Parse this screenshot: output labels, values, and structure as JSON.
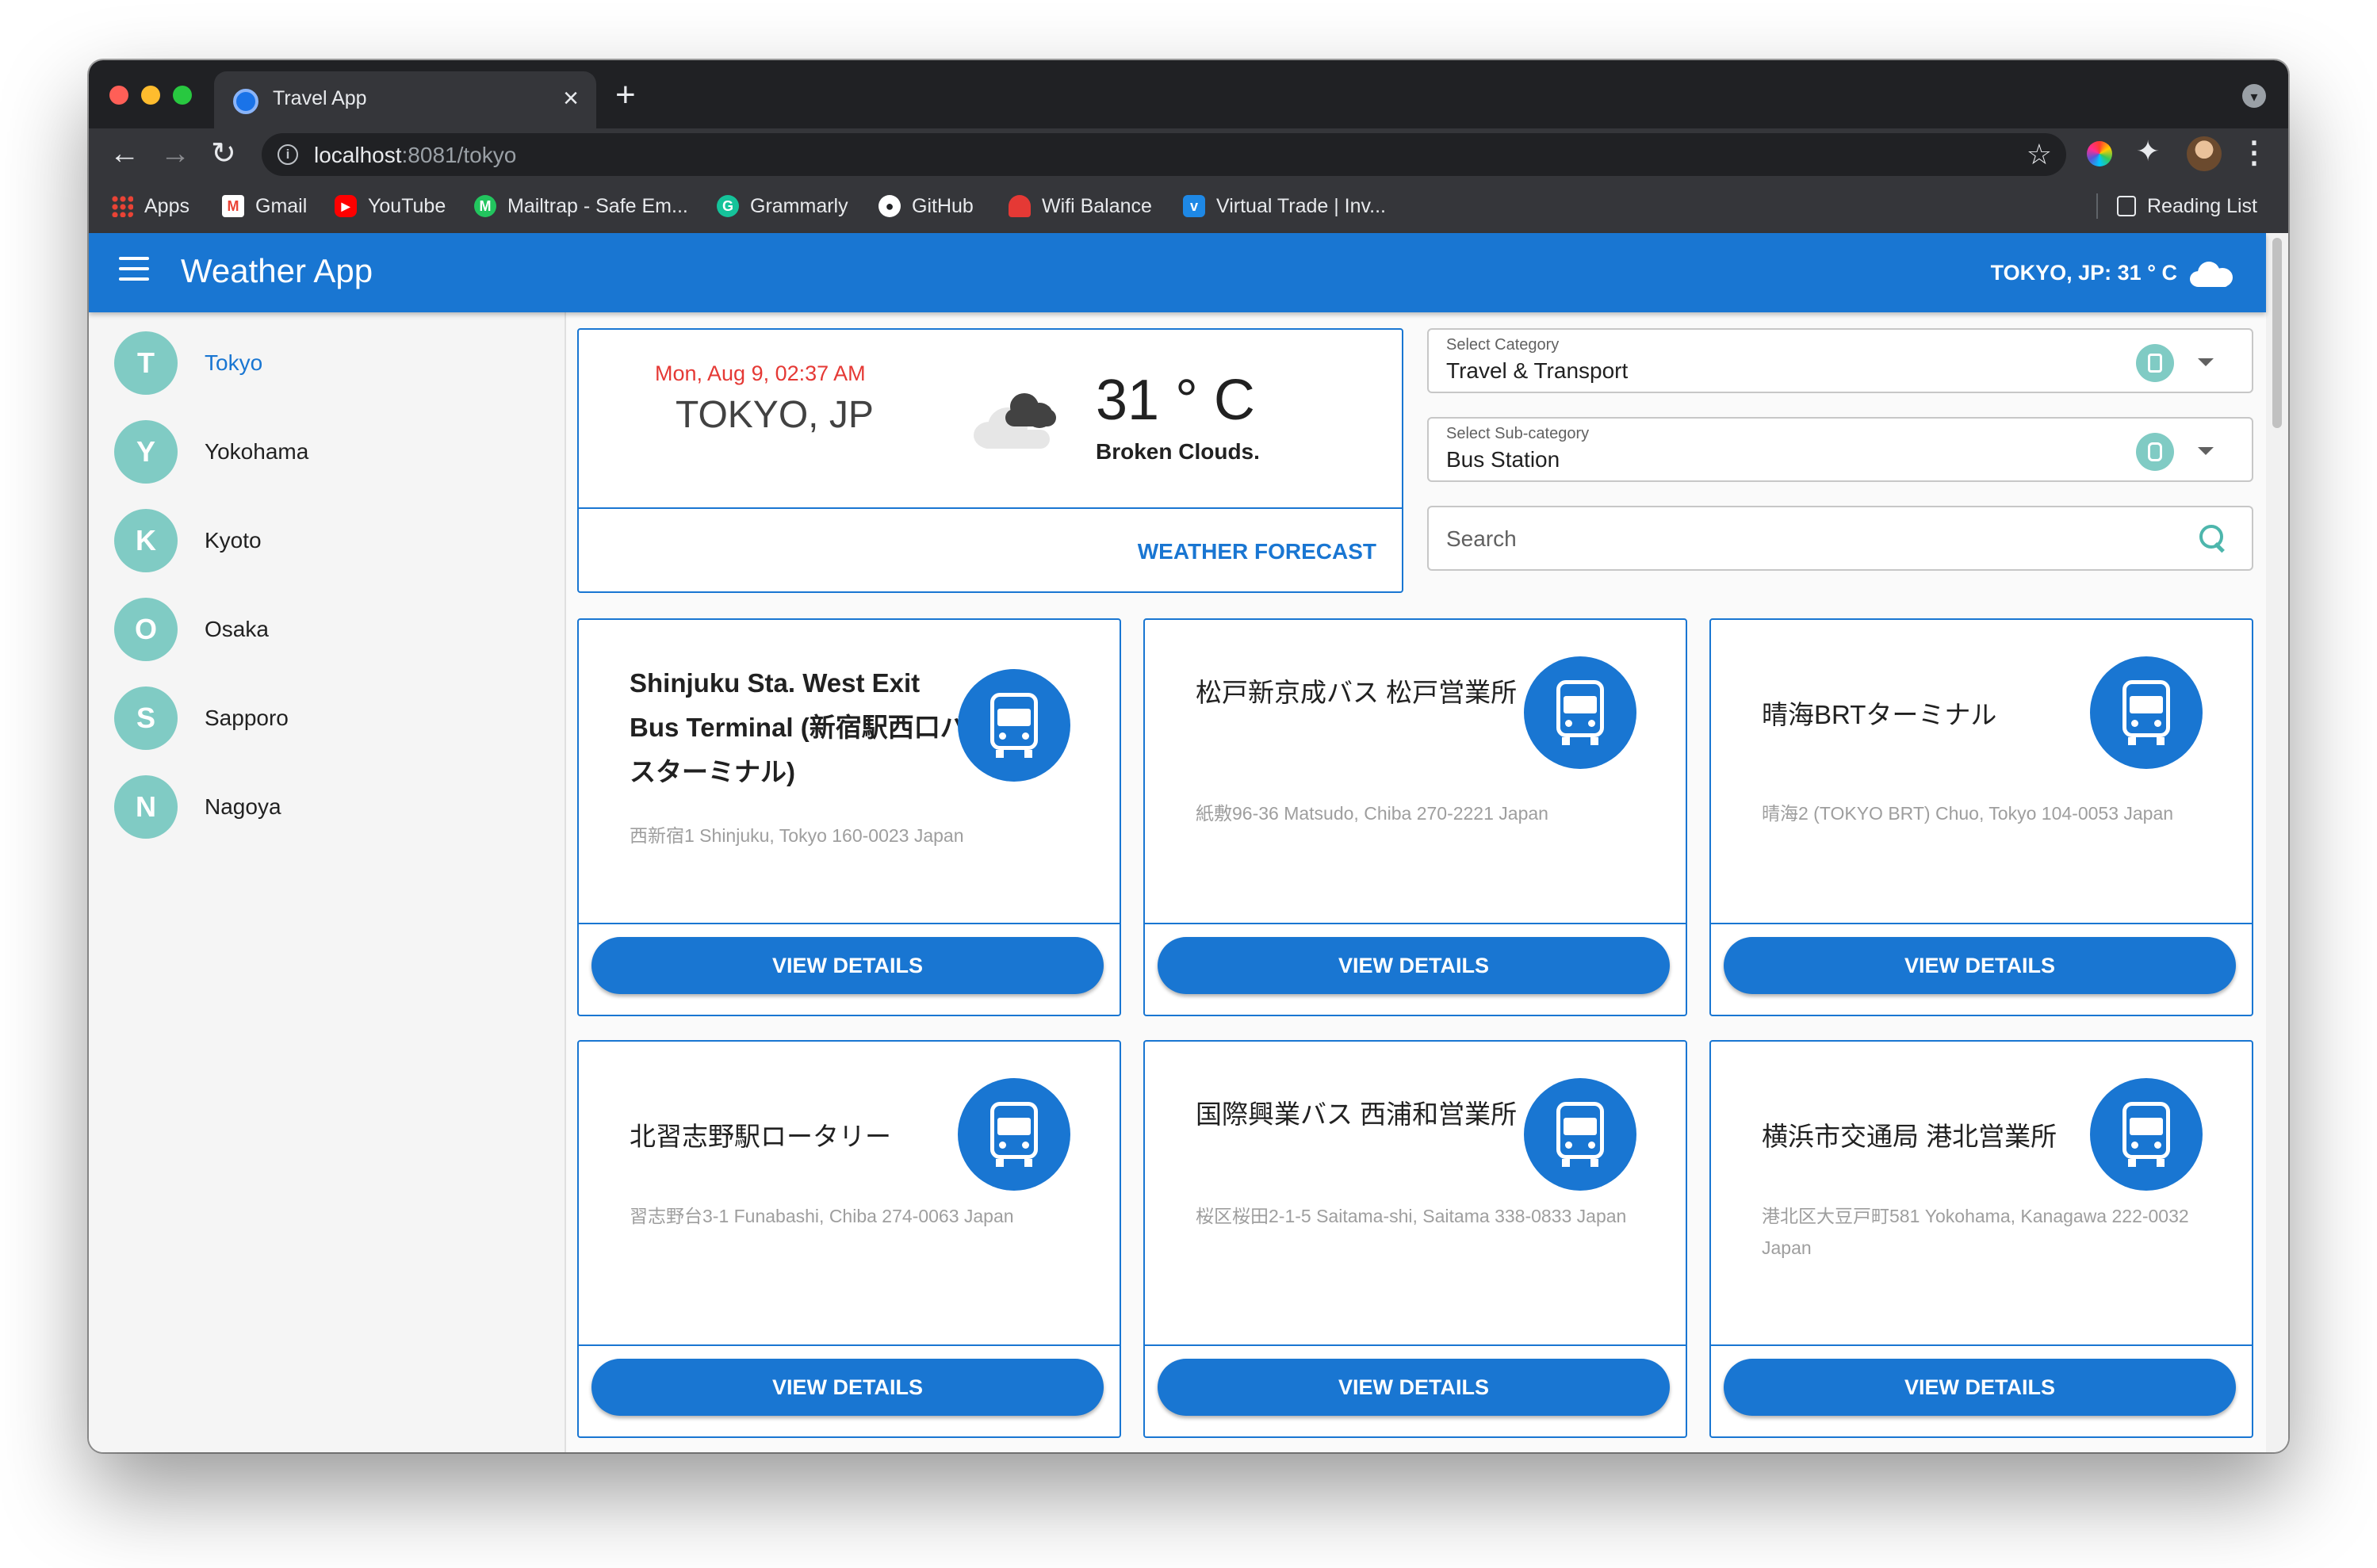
{
  "browser": {
    "tab_title": "Travel App",
    "tab_close": "×",
    "new_tab": "+",
    "url_host": "localhost",
    "url_rest": ":8081/tokyo",
    "back": "←",
    "forward": "→",
    "reload": "↻",
    "star": "☆",
    "puzzle": "✦",
    "menu": "⋮",
    "info": "i",
    "bookmarks": [
      {
        "label": "Apps",
        "icon": "apps-grid-icon"
      },
      {
        "label": "Gmail",
        "icon": "gmail-icon"
      },
      {
        "label": "YouTube",
        "icon": "youtube-icon"
      },
      {
        "label": "Mailtrap - Safe Em...",
        "icon": "mailtrap-icon"
      },
      {
        "label": "Grammarly",
        "icon": "grammarly-icon"
      },
      {
        "label": "GitHub",
        "icon": "github-icon"
      },
      {
        "label": "Wifi Balance",
        "icon": "wifi-balance-icon"
      },
      {
        "label": "Virtual Trade | Inv...",
        "icon": "virtual-trade-icon"
      }
    ],
    "reading_list": "Reading List"
  },
  "app": {
    "title": "Weather App",
    "header_weather": "TOKYO, JP: 31 ° C",
    "primary_color": "#1976d2",
    "accent_color": "#80cbc4"
  },
  "sidebar": {
    "cities": [
      {
        "initial": "T",
        "name": "Tokyo",
        "active": true
      },
      {
        "initial": "Y",
        "name": "Yokohama",
        "active": false
      },
      {
        "initial": "K",
        "name": "Kyoto",
        "active": false
      },
      {
        "initial": "O",
        "name": "Osaka",
        "active": false
      },
      {
        "initial": "S",
        "name": "Sapporo",
        "active": false
      },
      {
        "initial": "N",
        "name": "Nagoya",
        "active": false
      }
    ]
  },
  "weather": {
    "date": "Mon, Aug 9, 02:37 AM",
    "city": "TOKYO, JP",
    "temp": "31 ° C",
    "description": "Broken Clouds.",
    "forecast_link": "WEATHER FORECAST",
    "icon": "broken-clouds-icon"
  },
  "filters": {
    "category_label": "Select Category",
    "category_value": "Travel & Transport",
    "subcategory_label": "Select Sub-category",
    "subcategory_value": "Bus Station",
    "search_placeholder": "Search"
  },
  "places": [
    {
      "name": "Shinjuku Sta. West Exit Bus Terminal (新宿駅西口バスターミナル)",
      "address": "西新宿1 Shinjuku, Tokyo 160-0023 Japan",
      "button": "VIEW DETAILS"
    },
    {
      "name": "松戸新京成バス 松戸営業所",
      "address": "紙敷96-36 Matsudo, Chiba 270-2221 Japan",
      "button": "VIEW DETAILS"
    },
    {
      "name": "晴海BRTターミナル",
      "address": "晴海2 (TOKYO BRT) Chuo, Tokyo 104-0053 Japan",
      "button": "VIEW DETAILS"
    },
    {
      "name": "北習志野駅ロータリー",
      "address": "習志野台3-1 Funabashi, Chiba 274-0063 Japan",
      "button": "VIEW DETAILS"
    },
    {
      "name": "国際興業バス 西浦和営業所",
      "address": "桜区桜田2-1-5 Saitama-shi, Saitama 338-0833 Japan",
      "button": "VIEW DETAILS"
    },
    {
      "name": "横浜市交通局 港北営業所",
      "address": "港北区大豆戸町581 Yokohama, Kanagawa 222-0032 Japan",
      "button": "VIEW DETAILS"
    }
  ]
}
